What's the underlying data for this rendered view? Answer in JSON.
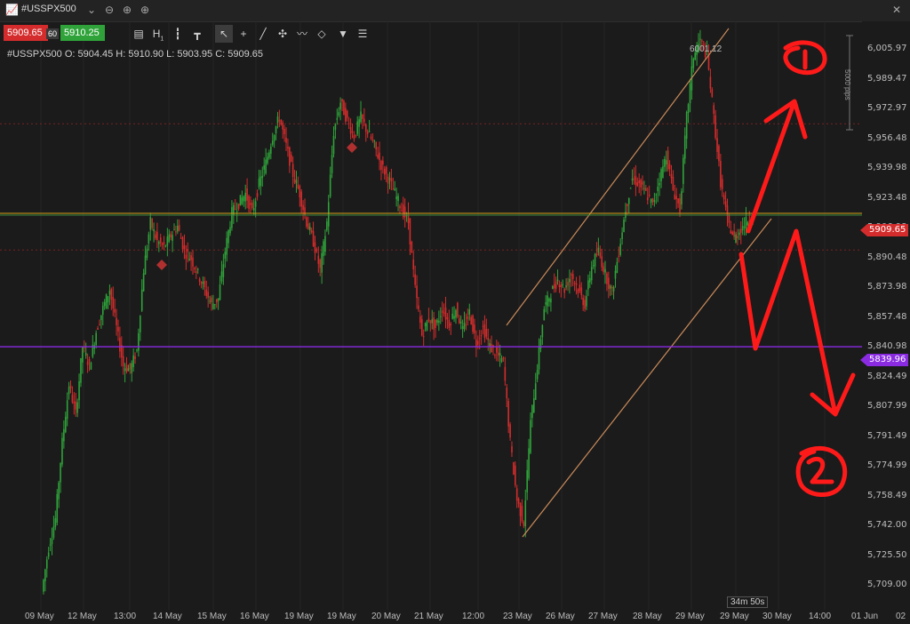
{
  "window": {
    "symbol": "#USSPX500",
    "symbol_dropdown_icon": "chevron-down-icon"
  },
  "trade": {
    "sell_price": "5909.65",
    "spread": "60",
    "buy_price": "5910.25"
  },
  "ohlc": {
    "text": "#USSPX500  O: 5904.45  H: 5910.90  L: 5903.95  C: 5909.65"
  },
  "price_axis": {
    "ticks": [
      "6,005.97",
      "5,989.47",
      "5,972.97",
      "5,956.48",
      "5,939.98",
      "5,923.48",
      "5,906.98",
      "5,890.48",
      "5,873.98",
      "5,857.48",
      "5,840.98",
      "5,824.49",
      "5,807.99",
      "5,791.49",
      "5,774.99",
      "5,758.49",
      "5,742.00",
      "5,725.50",
      "5,709.00"
    ],
    "current_price_tag": "5909.65",
    "purple_level_tag": "5839.96"
  },
  "time_axis": {
    "ticks": [
      "09 May",
      "12 May",
      "13:00",
      "14 May",
      "15 May",
      "16 May",
      "19 May",
      "19 May",
      "20 May",
      "21 May",
      "12:00",
      "23 May",
      "26 May",
      "27 May",
      "28 May",
      "29 May",
      "29 May",
      "30 May",
      "14:00",
      "01 Jun",
      "02"
    ]
  },
  "annotations": {
    "peak_label": "6001.12",
    "pips_label": "5000 pips",
    "timer": "34m 50s"
  },
  "colors": {
    "bull": "#2fa33a",
    "bear": "#d42c2c",
    "channel": "#c98a5a",
    "purple": "#8a2be2",
    "marker": "#ff1a1a",
    "current": "#d4a017"
  },
  "chart_data": {
    "type": "candlestick",
    "title": "",
    "ylim": [
      5709.0,
      6010.0
    ],
    "current_price": 5909.65,
    "level_purple": 5839.96,
    "level_red_dotted": [
      5956.48,
      5890.48
    ],
    "series": [
      {
        "values": [
          5712,
          5735,
          5750,
          5790,
          5820,
          5805,
          5840,
          5830,
          5848,
          5860,
          5870,
          5850,
          5830,
          5828,
          5838,
          5880,
          5905,
          5895,
          5892,
          5898,
          5903,
          5890,
          5886,
          5878,
          5870,
          5862,
          5865,
          5890,
          5910,
          5915,
          5920,
          5910,
          5925,
          5936,
          5950,
          5960,
          5945,
          5930,
          5920,
          5905,
          5895,
          5880,
          5905,
          5952,
          5968,
          5958,
          5950,
          5960,
          5952,
          5945,
          5935,
          5928,
          5920,
          5912,
          5905,
          5870,
          5846,
          5855,
          5850,
          5860,
          5852,
          5860,
          5848,
          5858,
          5842,
          5850,
          5840,
          5836,
          5832,
          5790,
          5760,
          5748,
          5800,
          5830,
          5860,
          5868,
          5875,
          5870,
          5878,
          5870,
          5862,
          5882,
          5890,
          5878,
          5868,
          5890,
          5912,
          5928,
          5925,
          5920,
          5914,
          5928,
          5940,
          5922,
          5912,
          5960,
          5992,
          6000,
          5992,
          5960,
          5926,
          5906,
          5896,
          5902,
          5906,
          5909.65
        ]
      }
    ]
  }
}
